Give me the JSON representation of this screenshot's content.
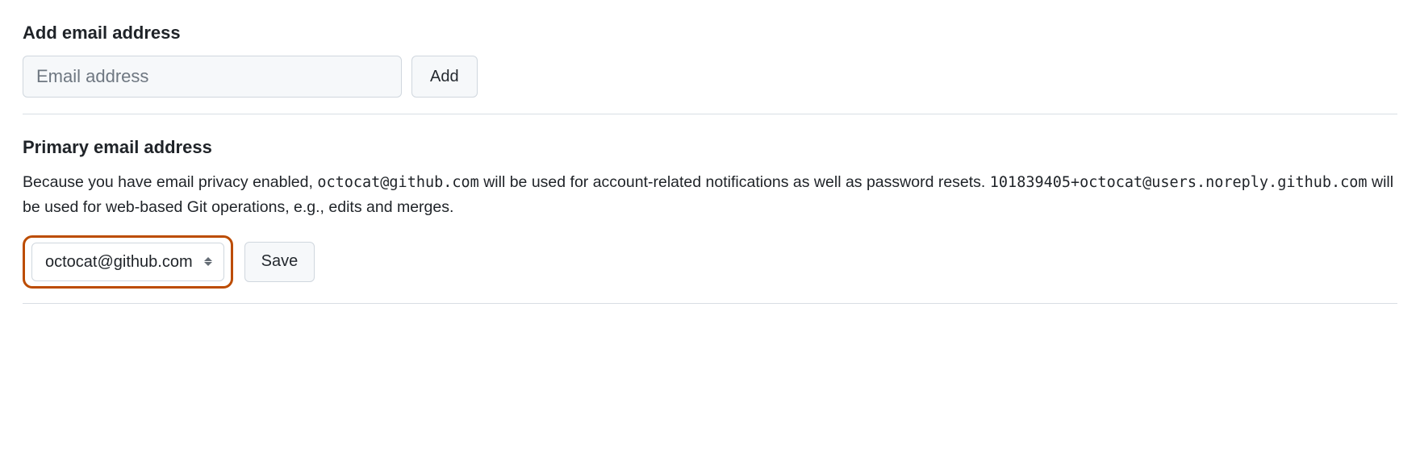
{
  "add_email": {
    "title": "Add email address",
    "placeholder": "Email address",
    "button_label": "Add"
  },
  "primary_email": {
    "title": "Primary email address",
    "desc_part1": "Because you have email privacy enabled, ",
    "email_account": "octocat@github.com",
    "desc_part2": " will be used for account-related notifications as well as password resets. ",
    "email_noreply": "101839405+octocat@users.noreply.github.com",
    "desc_part3": " will be used for web-based Git operations, e.g., edits and merges.",
    "selected": "octocat@github.com",
    "save_label": "Save"
  }
}
